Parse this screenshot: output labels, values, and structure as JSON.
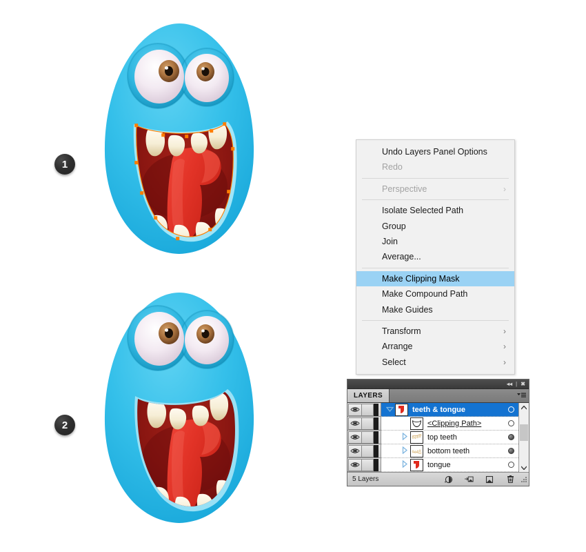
{
  "steps": [
    {
      "label": "1"
    },
    {
      "label": "2"
    }
  ],
  "context_menu": {
    "name": "illustrator-context-menu",
    "items": [
      {
        "label": "Undo Layers Panel Options",
        "state": "enabled",
        "submenu": false,
        "separator_after": false
      },
      {
        "label": "Redo",
        "state": "disabled",
        "submenu": false,
        "separator_after": true
      },
      {
        "label": "Perspective",
        "state": "disabled",
        "submenu": true,
        "separator_after": true
      },
      {
        "label": "Isolate Selected Path",
        "state": "enabled",
        "submenu": false,
        "separator_after": false
      },
      {
        "label": "Group",
        "state": "enabled",
        "submenu": false,
        "separator_after": false
      },
      {
        "label": "Join",
        "state": "enabled",
        "submenu": false,
        "separator_after": false
      },
      {
        "label": "Average...",
        "state": "enabled",
        "submenu": false,
        "separator_after": true
      },
      {
        "label": "Make Clipping Mask",
        "state": "selected",
        "submenu": false,
        "separator_after": false
      },
      {
        "label": "Make Compound Path",
        "state": "enabled",
        "submenu": false,
        "separator_after": false
      },
      {
        "label": "Make Guides",
        "state": "enabled",
        "submenu": false,
        "separator_after": true
      },
      {
        "label": "Transform",
        "state": "enabled",
        "submenu": true,
        "separator_after": false
      },
      {
        "label": "Arrange",
        "state": "enabled",
        "submenu": true,
        "separator_after": false
      },
      {
        "label": "Select",
        "state": "enabled",
        "submenu": true,
        "separator_after": false
      }
    ],
    "submenu_glyph": "›",
    "highlight_color": "#9ad2f4"
  },
  "layers_panel": {
    "tab_label": "LAYERS",
    "collapse_glyph": "◂◂",
    "close_glyph": "✖",
    "menu_glyph": "▾☰",
    "rows": [
      {
        "name": "teeth & tongue",
        "indent": 0,
        "selected": true,
        "disclosure": "open",
        "target_filled": false,
        "underline": false,
        "thumb": "tongue-thumb",
        "eye": "visible",
        "locked": false
      },
      {
        "name": "<Clipping Path>",
        "indent": 1,
        "selected": false,
        "disclosure": "none",
        "target_filled": false,
        "underline": true,
        "thumb": "clipping-path-thumb",
        "eye": "visible",
        "locked": false
      },
      {
        "name": "top teeth",
        "indent": 1,
        "selected": false,
        "disclosure": "closed",
        "target_filled": true,
        "underline": false,
        "thumb": "top-teeth-thumb",
        "eye": "visible",
        "locked": false
      },
      {
        "name": "bottom teeth",
        "indent": 1,
        "selected": false,
        "disclosure": "closed",
        "target_filled": true,
        "underline": false,
        "thumb": "bottom-teeth-thumb",
        "eye": "visible",
        "locked": false
      },
      {
        "name": "tongue",
        "indent": 1,
        "selected": false,
        "disclosure": "closed",
        "target_filled": false,
        "underline": false,
        "thumb": "tongue-thumb",
        "eye": "visible",
        "locked": false
      }
    ],
    "footer": {
      "count_label": "5 Layers",
      "buttons": [
        "make-clipping-mask-icon",
        "create-new-sublayer-icon",
        "create-new-layer-icon",
        "delete-selection-icon"
      ]
    },
    "selection_color": "#1473d1"
  },
  "artwork": {
    "monsters": [
      {
        "id": "monster-step-1",
        "path_selected": true,
        "label": "blue monster with selected mouth path"
      },
      {
        "id": "monster-step-2",
        "path_selected": false,
        "label": "blue monster with clipped teeth and tongue"
      }
    ],
    "colors": {
      "body_blue": "#35c0ea",
      "body_blue_dark": "#1ba8d8",
      "mouth_dark_red": "#7d1210",
      "mouth_mid_red": "#9c1a14",
      "tongue_red": "#e8342a",
      "tooth_cream": "#f6efd8",
      "eye_white": "#f0e7ef",
      "iris_brown": "#b0763f",
      "selection_path_orange": "#ff7e00"
    }
  }
}
